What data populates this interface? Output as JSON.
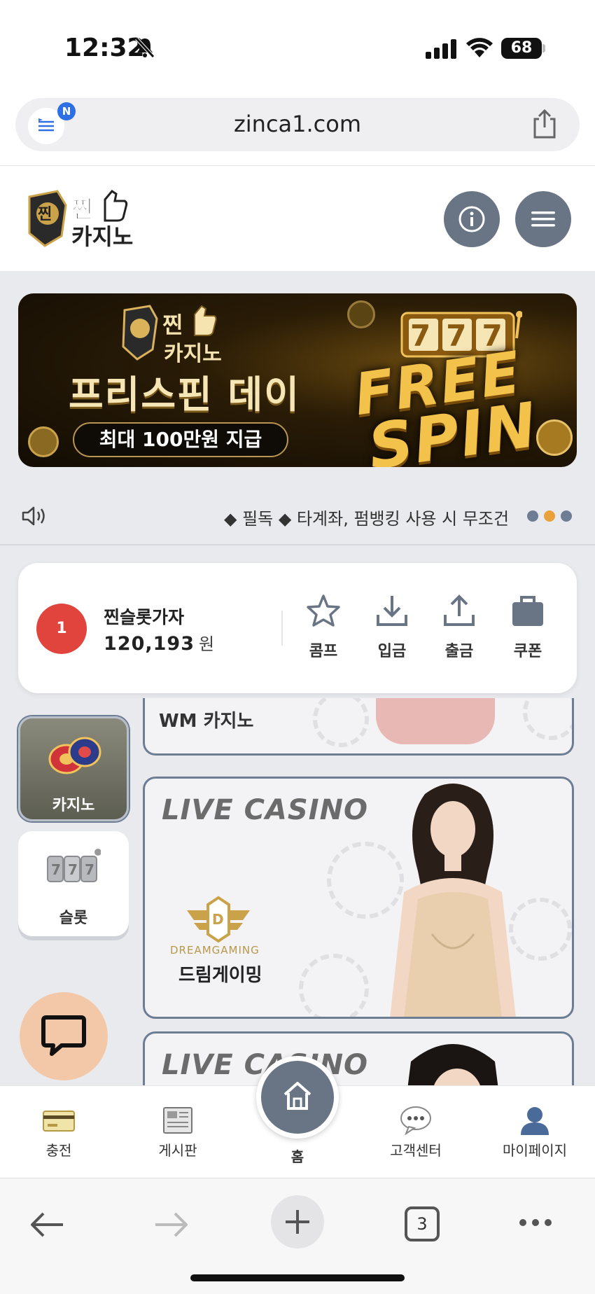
{
  "status_bar": {
    "time": "12:32",
    "battery": "68"
  },
  "browser": {
    "url": "zinca1.com",
    "n_badge": "N",
    "tab_count": "3"
  },
  "banner": {
    "title": "프리스핀 데이",
    "subtitle": "최대 100만원 지급",
    "free": "FREE",
    "spin": "SPIN",
    "slot_digits": "777"
  },
  "notice": {
    "text": "◆ 필독 ◆ 타계좌, 펌뱅킹 사용 시 무조건"
  },
  "user": {
    "level": "1",
    "name": "찐슬롯가자",
    "balance": "120,193",
    "currency": "원"
  },
  "actions": [
    {
      "label": "콤프",
      "icon": "star-icon"
    },
    {
      "label": "입금",
      "icon": "download-icon"
    },
    {
      "label": "출금",
      "icon": "upload-icon"
    },
    {
      "label": "쿠폰",
      "icon": "briefcase-icon"
    }
  ],
  "categories": [
    {
      "label": "카지노",
      "icon": "casino-chips-icon",
      "active": true
    },
    {
      "label": "슬롯",
      "icon": "slot-reels-icon",
      "active": false
    }
  ],
  "games": [
    {
      "title": "WM 카지노"
    },
    {
      "title": "LIVE CASINO",
      "brand": "DREAMGAMING",
      "name": "드림게이밍"
    },
    {
      "title": "LIVE CASINO"
    }
  ],
  "bottom_nav": {
    "charge": "충전",
    "board": "게시판",
    "home": "홈",
    "support": "고객센터",
    "mypage": "마이페이지"
  },
  "colors": {
    "accent_slate": "#697585",
    "level_red": "#e0443c",
    "dot_active": "#e9a23b",
    "chat_peach": "#f3c8a8"
  }
}
